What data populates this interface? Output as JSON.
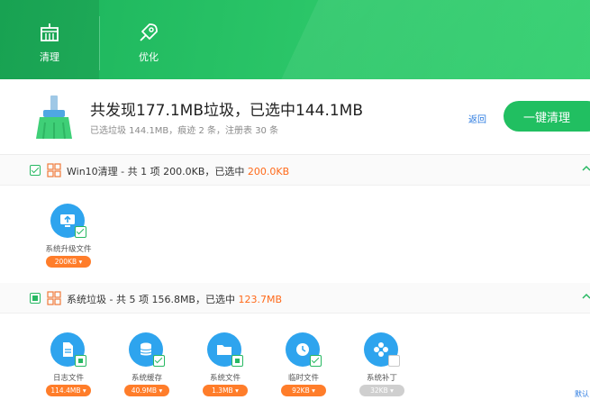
{
  "nav": {
    "tabs": [
      {
        "label": "清理",
        "icon": "broom-icon",
        "active": true
      },
      {
        "label": "优化",
        "icon": "rocket-icon",
        "active": false
      }
    ]
  },
  "summary": {
    "title": "共发现177.1MB垃圾，已选中144.1MB",
    "subtitle": "已选垃圾 144.1MB，痕迹 2 条，注册表 30 条",
    "back_label": "返回",
    "clean_button_label": "一键清理"
  },
  "sections": [
    {
      "title": "Win10清理 - 共 1 项 200.0KB，已选中 ",
      "selected": "200.0KB",
      "checked": "checked",
      "items": [
        {
          "label": "系统升级文件",
          "size": "200KB",
          "icon": "monitor-upload-icon",
          "state": "checked"
        }
      ]
    },
    {
      "title": "系统垃圾 - 共 5 项 156.8MB，已选中 ",
      "selected": "123.7MB",
      "checked": "partial",
      "items": [
        {
          "label": "日志文件",
          "size": "114.4MB",
          "icon": "document-icon",
          "state": "partial"
        },
        {
          "label": "系统缓存",
          "size": "40.9MB",
          "icon": "database-icon",
          "state": "checked"
        },
        {
          "label": "系统文件",
          "size": "1.3MB",
          "icon": "folder-icon",
          "state": "partial"
        },
        {
          "label": "临时文件",
          "size": "92KB",
          "icon": "clock-icon",
          "state": "checked"
        },
        {
          "label": "系统补丁",
          "size": "32KB",
          "icon": "puzzle-icon",
          "state": "empty"
        }
      ]
    }
  ],
  "footer": {
    "corner_link": "默认"
  },
  "colors": {
    "brand_green": "#21bf61",
    "accent_orange": "#ff6a1a",
    "icon_blue": "#2ea4ee"
  }
}
